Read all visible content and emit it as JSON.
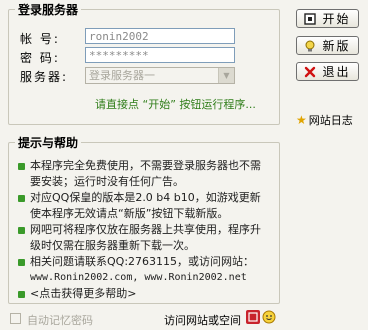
{
  "login_group": {
    "title": "登录服务器",
    "account_label": "帐  号:",
    "account_value": "ronin2002",
    "password_label": "密  码:",
    "password_value": "*********",
    "server_label": "服务器:",
    "server_value": "登录服务器一",
    "hint": "请直接点 “开始” 按钮运行程序..."
  },
  "buttons": {
    "start": "开始",
    "new_version": "新版",
    "exit": "退出"
  },
  "site_log": "网站日志",
  "help_group": {
    "title": "提示与帮助",
    "items": [
      "本程序完全免费使用，不需要登录服务器也不需要安装；运行时没有任何广告。",
      "对应QQ保皇的版本是2.0 b4 b10，如游戏更新使本程序无效请点“新版”按钮下载新版。",
      "网吧可将程序仅放在服务器上共享使用，程序升级时仅需在服务器重新下载一次。",
      "相关问题请联系QQ:2763115，或访问网站：",
      "<点击获得更多帮助>"
    ],
    "urls": "www.Ronin2002.com, www.Ronin2002.net"
  },
  "bottom": {
    "remember_password": "自动记忆密码",
    "visit": "访问网站或空间"
  },
  "colors": {
    "hint_green": "#2e7d18",
    "bullet_green": "#3a9a2a",
    "exit_red": "#d01010"
  }
}
